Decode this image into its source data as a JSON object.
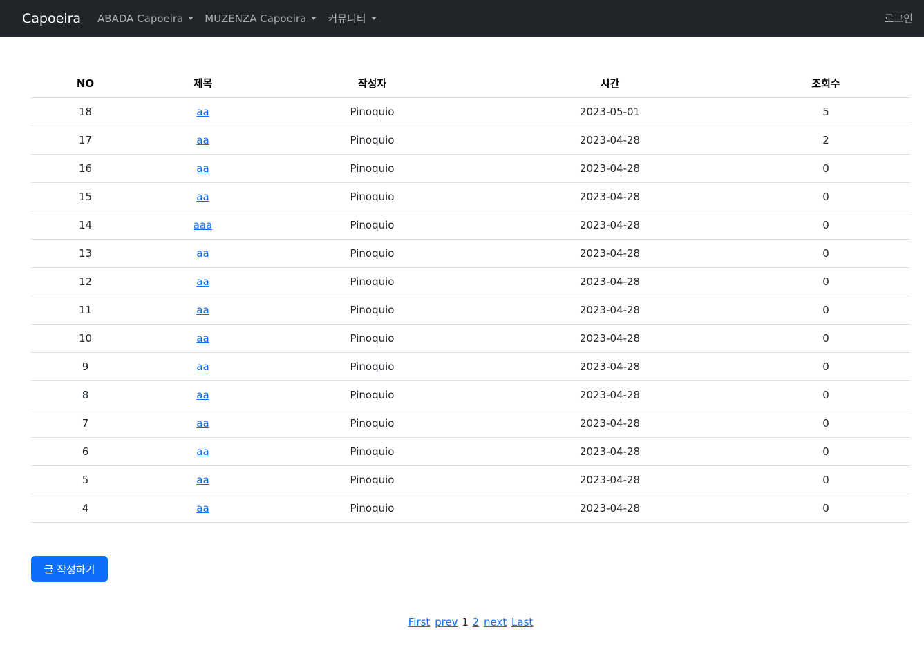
{
  "navbar": {
    "brand": "Capoeira",
    "menus": [
      {
        "label": "ABADA Capoeira"
      },
      {
        "label": "MUZENZA Capoeira"
      },
      {
        "label": "커뮤니티"
      }
    ],
    "login": "로그인"
  },
  "table": {
    "headers": {
      "no": "NO",
      "title": "제목",
      "author": "작성자",
      "time": "시간",
      "views": "조회수"
    },
    "rows": [
      {
        "no": "18",
        "title": "aa",
        "author": "Pinoquio",
        "time": "2023-05-01",
        "views": "5"
      },
      {
        "no": "17",
        "title": "aa",
        "author": "Pinoquio",
        "time": "2023-04-28",
        "views": "2"
      },
      {
        "no": "16",
        "title": "aa",
        "author": "Pinoquio",
        "time": "2023-04-28",
        "views": "0"
      },
      {
        "no": "15",
        "title": "aa",
        "author": "Pinoquio",
        "time": "2023-04-28",
        "views": "0"
      },
      {
        "no": "14",
        "title": "aaa",
        "author": "Pinoquio",
        "time": "2023-04-28",
        "views": "0"
      },
      {
        "no": "13",
        "title": "aa",
        "author": "Pinoquio",
        "time": "2023-04-28",
        "views": "0"
      },
      {
        "no": "12",
        "title": "aa",
        "author": "Pinoquio",
        "time": "2023-04-28",
        "views": "0"
      },
      {
        "no": "11",
        "title": "aa",
        "author": "Pinoquio",
        "time": "2023-04-28",
        "views": "0"
      },
      {
        "no": "10",
        "title": "aa",
        "author": "Pinoquio",
        "time": "2023-04-28",
        "views": "0"
      },
      {
        "no": "9",
        "title": "aa",
        "author": "Pinoquio",
        "time": "2023-04-28",
        "views": "0"
      },
      {
        "no": "8",
        "title": "aa",
        "author": "Pinoquio",
        "time": "2023-04-28",
        "views": "0"
      },
      {
        "no": "7",
        "title": "aa",
        "author": "Pinoquio",
        "time": "2023-04-28",
        "views": "0"
      },
      {
        "no": "6",
        "title": "aa",
        "author": "Pinoquio",
        "time": "2023-04-28",
        "views": "0"
      },
      {
        "no": "5",
        "title": "aa",
        "author": "Pinoquio",
        "time": "2023-04-28",
        "views": "0"
      },
      {
        "no": "4",
        "title": "aa",
        "author": "Pinoquio",
        "time": "2023-04-28",
        "views": "0"
      }
    ]
  },
  "write_button": "글 작성하기",
  "pagination": {
    "first": "First",
    "prev": "prev",
    "current": "1",
    "pages": [
      "2"
    ],
    "next": "next",
    "last": "Last"
  },
  "colors": {
    "navbar_bg": "#212529",
    "link": "#0d6efd",
    "primary_button": "#0d6efd"
  }
}
